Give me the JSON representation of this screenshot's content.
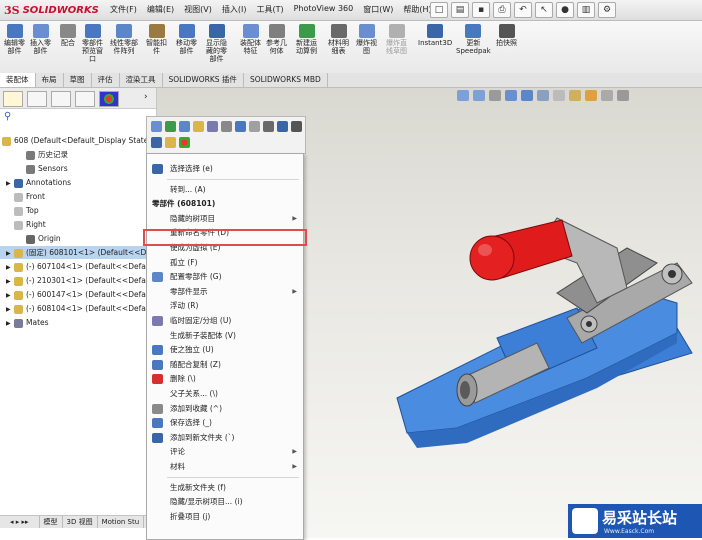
{
  "app": {
    "logo_ds": "3S",
    "logo_name": "SOLIDWORKS"
  },
  "menubar": [
    "文件(F)",
    "编辑(E)",
    "视图(V)",
    "插入(I)",
    "工具(T)",
    "PhotoView 360",
    "窗口(W)",
    "帮助(H)"
  ],
  "ribbon": [
    {
      "label": "编辑零\n部件",
      "color": "#4a78c0",
      "disabled": false
    },
    {
      "label": "插入零\n部件",
      "color": "#6a8fd0",
      "disabled": false
    },
    {
      "label": "配合",
      "color": "#888888",
      "disabled": false
    },
    {
      "label": "零部件\n预览窗\n口",
      "color": "#4a78c0",
      "disabled": false
    },
    {
      "label": "线性零部\n件阵列",
      "color": "#5b86c8",
      "disabled": false
    },
    {
      "label": "智能扣\n件",
      "color": "#9a7a40",
      "disabled": false
    },
    {
      "label": "移动零\n部件",
      "color": "#4a78c0",
      "disabled": false
    },
    {
      "label": "显示隐\n藏的零\n部件",
      "color": "#3a66a8",
      "disabled": false
    },
    {
      "label": "装配体\n特征",
      "color": "#6a8fd0",
      "disabled": false
    },
    {
      "label": "参考几\n何体",
      "color": "#7f7f7f",
      "disabled": false
    },
    {
      "label": "新建运\n动算例",
      "color": "#3c9a4a",
      "disabled": false
    },
    {
      "label": "材料明\n细表",
      "color": "#6a6a6a",
      "disabled": false
    },
    {
      "label": "爆炸视\n图",
      "color": "#6a8fd0",
      "disabled": false
    },
    {
      "label": "爆炸直\n线草图",
      "color": "#b0b0b0",
      "disabled": true
    },
    {
      "label": "Instant3D",
      "color": "#3a66a8",
      "disabled": false
    },
    {
      "label": "更新\nSpeedpak",
      "color": "#4a78c0",
      "disabled": false
    },
    {
      "label": "拍快照",
      "color": "#555555",
      "disabled": false
    }
  ],
  "tabs": [
    "装配体",
    "布局",
    "草图",
    "评估",
    "渲染工具",
    "SOLIDWORKS 插件",
    "SOLIDWORKS MBD"
  ],
  "tree": {
    "root": "608  (Default<Default_Display State",
    "items": [
      {
        "label": "历史记录",
        "color": "#7a7a7a",
        "selected": false
      },
      {
        "label": "Sensors",
        "color": "#7a7a7a",
        "selected": false
      },
      {
        "label": "Annotations",
        "color": "#3a66a8",
        "selected": false
      },
      {
        "label": "Front",
        "color": "#bcbcbc",
        "selected": false
      },
      {
        "label": "Top",
        "color": "#bcbcbc",
        "selected": false
      },
      {
        "label": "Right",
        "color": "#bcbcbc",
        "selected": false
      },
      {
        "label": "Origin",
        "color": "#666666",
        "selected": false
      },
      {
        "label": "(固定) 608101<1> (Default<<De",
        "color": "#d8b64a",
        "selected": true
      },
      {
        "label": "(-) 607104<1> (Default<<Defau",
        "color": "#d8b64a",
        "selected": false
      },
      {
        "label": "(-) 210301<1> (Default<<Defau",
        "color": "#d8b64a",
        "selected": false
      },
      {
        "label": "(-) 600147<1> (Default<<Defau",
        "color": "#d8b64a",
        "selected": false
      },
      {
        "label": "(-) 608104<1> (Default<<Defau",
        "color": "#d8b64a",
        "selected": false
      },
      {
        "label": "Mates",
        "color": "#7a7a9a",
        "selected": false
      }
    ]
  },
  "bottom_tabs": [
    "模型",
    "3D 视图",
    "Motion Stu"
  ],
  "context_menu": {
    "items": [
      {
        "label": "选择选择 (e)",
        "icon": "#3a66a8",
        "arrow": false,
        "header": false
      },
      {
        "sep": true
      },
      {
        "label": "转到... (A)",
        "icon": "",
        "arrow": false,
        "header": false
      },
      {
        "label": "零部件 (608101)",
        "icon": "",
        "arrow": false,
        "header": true
      },
      {
        "label": "隐藏的树项目",
        "icon": "",
        "arrow": true,
        "header": false
      },
      {
        "label": "重新命名零件 (D)",
        "icon": "",
        "arrow": false,
        "header": false
      },
      {
        "label": "使成为虚拟 (E)",
        "icon": "",
        "arrow": false,
        "header": false
      },
      {
        "label": "孤立 (F)",
        "icon": "",
        "arrow": false,
        "header": false
      },
      {
        "label": "配置零部件 (G)",
        "icon": "#5b86c8",
        "arrow": false,
        "header": false
      },
      {
        "label": "零部件显示",
        "icon": "",
        "arrow": true,
        "header": false
      },
      {
        "label": "浮动 (R)",
        "icon": "",
        "arrow": false,
        "header": false
      },
      {
        "label": "临时固定/分组 (U)",
        "icon": "#7a7ab0",
        "arrow": false,
        "header": false
      },
      {
        "label": "生成新子装配体 (V)",
        "icon": "",
        "arrow": false,
        "header": false
      },
      {
        "label": "使之独立 (U)",
        "icon": "#4a78c0",
        "arrow": false,
        "header": false
      },
      {
        "label": "随配合复制 (Z)",
        "icon": "#4a78c0",
        "arrow": false,
        "header": false
      },
      {
        "label": "删除 (\\)",
        "icon": "#d62f2f",
        "arrow": false,
        "header": false
      },
      {
        "label": "父子关系... (\\)",
        "icon": "",
        "arrow": false,
        "header": false
      },
      {
        "label": "添加到收藏 (^)",
        "icon": "#8a8a8a",
        "arrow": false,
        "header": false
      },
      {
        "label": "保存选择 (_)",
        "icon": "#4a78c0",
        "arrow": false,
        "header": false
      },
      {
        "label": "添加到新文件夹 (`)",
        "icon": "#3a66a8",
        "arrow": false,
        "header": false
      },
      {
        "label": "评论",
        "icon": "",
        "arrow": true,
        "header": false
      },
      {
        "label": "材料",
        "icon": "",
        "arrow": true,
        "header": false
      },
      {
        "sep": true
      },
      {
        "label": "生成新文件夹 (f)",
        "icon": "",
        "arrow": false,
        "header": false
      },
      {
        "label": "隐藏/显示树项目... (i)",
        "icon": "",
        "arrow": false,
        "header": false
      },
      {
        "label": "折叠项目 (j)",
        "icon": "",
        "arrow": false,
        "header": false
      }
    ]
  },
  "watermark": {
    "title": "易采站长站",
    "subtitle": "Www.Easck.Com"
  }
}
